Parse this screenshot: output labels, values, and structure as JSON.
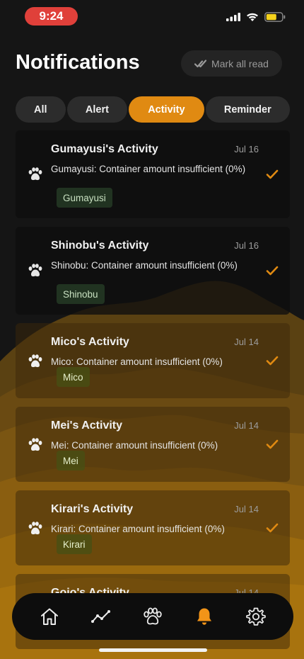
{
  "status_bar": {
    "time": "9:24"
  },
  "header": {
    "title": "Notifications",
    "mark_all_label": "Mark all read"
  },
  "tabs": [
    {
      "label": "All",
      "active": false
    },
    {
      "label": "Alert",
      "active": false
    },
    {
      "label": "Activity",
      "active": true
    },
    {
      "label": "Reminder",
      "active": false
    }
  ],
  "notifications": [
    {
      "title": "Gumayusi's Activity",
      "date": "Jul 16",
      "body": "Gumayusi: Container amount insufficient (0%)",
      "tag": "Gumayusi"
    },
    {
      "title": "Shinobu's Activity",
      "date": "Jul 16",
      "body": "Shinobu: Container amount insufficient (0%)",
      "tag": "Shinobu"
    },
    {
      "title": "Mico's Activity",
      "date": "Jul 14",
      "body": "Mico: Container amount insufficient (0%)",
      "tag": "Mico"
    },
    {
      "title": "Mei's Activity",
      "date": "Jul 14",
      "body": "Mei: Container amount insufficient (0%)",
      "tag": "Mei"
    },
    {
      "title": "Kirari's Activity",
      "date": "Jul 14",
      "body": "Kirari: Container amount insufficient (0%)",
      "tag": "Kirari"
    },
    {
      "title": "Gojo's Activity",
      "date": "Jul 14",
      "body": "",
      "tag": ""
    }
  ],
  "bottom_nav": {
    "items": [
      {
        "icon": "home-icon",
        "active": false
      },
      {
        "icon": "activity-chart-icon",
        "active": false
      },
      {
        "icon": "paw-icon",
        "active": false
      },
      {
        "icon": "bell-icon",
        "active": true
      },
      {
        "icon": "gear-icon",
        "active": false
      }
    ]
  },
  "colors": {
    "accent": "#e08a12",
    "status_time_bg": "#e0403a",
    "background": "#151515",
    "check": "#e08a12"
  }
}
